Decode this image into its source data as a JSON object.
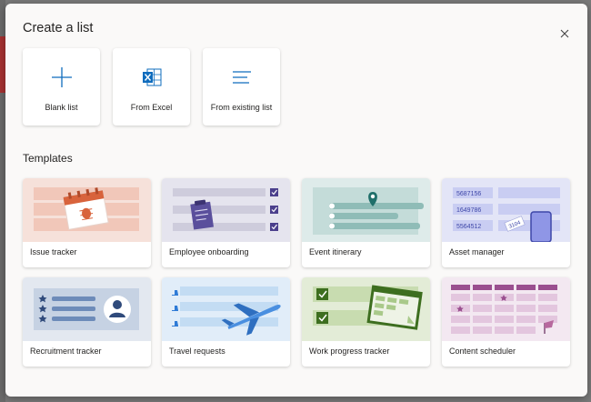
{
  "dialog": {
    "title": "Create a list"
  },
  "options": [
    {
      "label": "Blank list",
      "icon": "plus-icon"
    },
    {
      "label": "From Excel",
      "icon": "excel-icon"
    },
    {
      "label": "From existing list",
      "icon": "list-lines-icon"
    }
  ],
  "templates_heading": "Templates",
  "templates": [
    {
      "label": "Issue tracker",
      "icon": "calendar-bug-icon"
    },
    {
      "label": "Employee onboarding",
      "icon": "clipboard-checklist-icon"
    },
    {
      "label": "Event itinerary",
      "icon": "map-pin-icon"
    },
    {
      "label": "Asset manager",
      "icon": "tablet-tag-icon"
    },
    {
      "label": "Recruitment tracker",
      "icon": "person-profile-icon"
    },
    {
      "label": "Travel requests",
      "icon": "airplane-icon"
    },
    {
      "label": "Work progress tracker",
      "icon": "board-checklist-icon"
    },
    {
      "label": "Content scheduler",
      "icon": "calendar-flag-icon"
    }
  ],
  "asset_ids": [
    "5687156",
    "1649786",
    "5564512"
  ],
  "asset_tag": "3104",
  "colors": {
    "accent": "#0f6cbd",
    "excel": "#217346",
    "dialog_bg": "#faf9f8"
  }
}
